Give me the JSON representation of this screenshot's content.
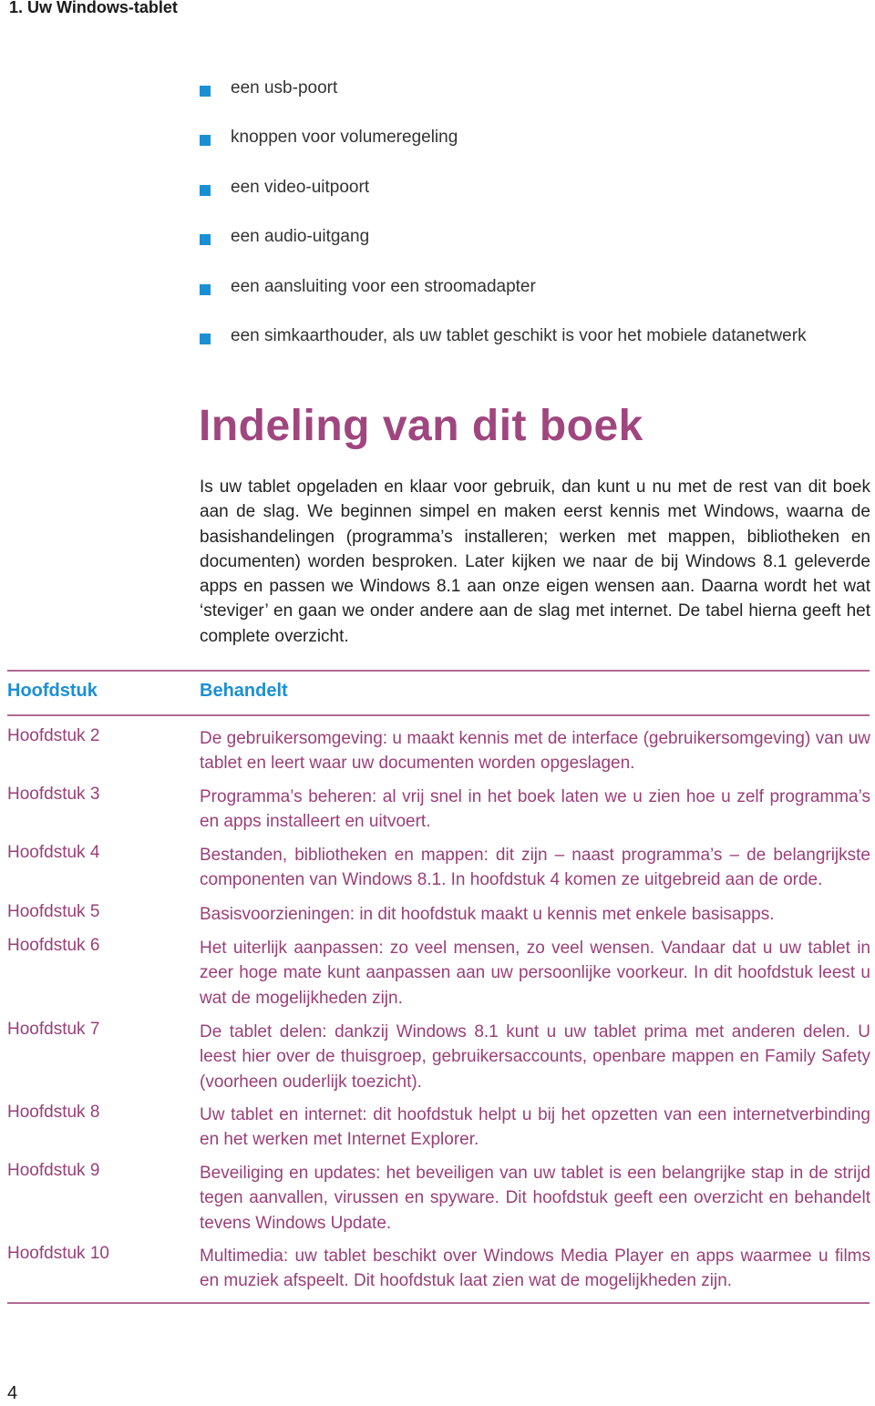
{
  "running_head": "1. Uw Windows-tablet",
  "bullets": [
    "een usb-poort",
    "knoppen voor volumeregeling",
    "een video-uitpoort",
    "een audio-uitgang",
    "een aansluiting voor een stroomadapter",
    "een simkaarthouder, als uw tablet geschikt is voor het mobiele datanetwerk"
  ],
  "section": {
    "title": "Indeling van dit boek",
    "intro": "Is uw tablet opgeladen en klaar voor gebruik, dan kunt u nu met de rest van dit boek aan de slag. We beginnen simpel en maken eerst kennis met Windows, waarna de basishandelingen (programma’s installeren; werken met mappen, bibliotheken en documenten) worden besproken. Later kijken we naar de bij Windows 8.1 geleverde apps en passen we Windows 8.1 aan onze eigen wensen aan. Daarna wordt het wat ‘steviger’ en gaan we onder andere aan de slag met internet. De tabel hierna geeft het complete overzicht."
  },
  "table": {
    "headers": [
      "Hoofdstuk",
      "Behandelt"
    ],
    "rows": [
      {
        "chapter": "Hoofdstuk 2",
        "description": "De gebruikersomgeving: u maakt kennis met de interface (gebruikersomgeving) van uw tablet en leert waar uw documenten worden opgeslagen."
      },
      {
        "chapter": "Hoofdstuk 3",
        "description": "Programma’s beheren: al vrij snel in het boek laten we u zien hoe u zelf programma’s en apps installeert en uitvoert."
      },
      {
        "chapter": "Hoofdstuk 4",
        "description": "Bestanden, bibliotheken en mappen: dit zijn – naast programma’s – de belangrijkste componenten van Windows 8.1. In hoofdstuk 4 komen ze uitgebreid aan de orde."
      },
      {
        "chapter": "Hoofdstuk 5",
        "description": "Basisvoorzieningen: in dit hoofdstuk maakt u kennis met enkele basisapps."
      },
      {
        "chapter": "Hoofdstuk 6",
        "description": "Het uiterlijk aanpassen: zo veel mensen, zo veel wensen. Vandaar dat u uw tablet in zeer hoge mate kunt aanpassen aan uw persoonlijke voorkeur. In dit hoofdstuk leest u wat de mogelijkheden zijn."
      },
      {
        "chapter": "Hoofdstuk 7",
        "description": "De tablet delen: dankzij Windows 8.1 kunt u uw tablet prima met anderen delen. U leest hier over de thuisgroep, gebruikersaccounts, openbare mappen en Family Safety (voorheen ouderlijk toezicht)."
      },
      {
        "chapter": "Hoofdstuk 8",
        "description": "Uw tablet en internet: dit hoofdstuk helpt u bij het opzetten van een internetverbinding en het werken met Internet Explorer."
      },
      {
        "chapter": "Hoofdstuk 9",
        "description": "Beveiliging en updates: het beveiligen van uw tablet is een belangrijke stap in de strijd tegen aanvallen, virussen en spyware. Dit hoofdstuk geeft een overzicht en behandelt tevens Windows Update."
      },
      {
        "chapter": "Hoofdstuk 10",
        "description": "Multimedia: uw tablet beschikt over Windows Media Player en apps waarmee u films en muziek afspeelt. Dit hoofdstuk laat zien wat de mogelijkheden zijn."
      }
    ]
  },
  "page_number": "4"
}
